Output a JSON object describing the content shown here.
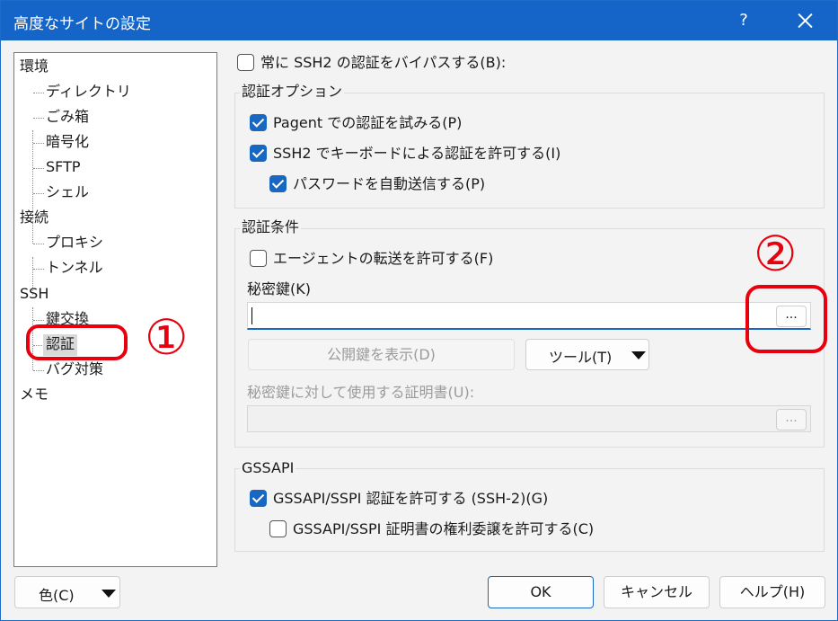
{
  "window": {
    "title": "高度なサイトの設定"
  },
  "titlebar": {
    "help_label": "?"
  },
  "tree": {
    "items": [
      {
        "label": "環境"
      },
      {
        "label": "ディレクトリ"
      },
      {
        "label": "ごみ箱"
      },
      {
        "label": "暗号化"
      },
      {
        "label": "SFTP"
      },
      {
        "label": "シェル"
      },
      {
        "label": "接続"
      },
      {
        "label": "プロキシ"
      },
      {
        "label": "トンネル"
      },
      {
        "label": "SSH"
      },
      {
        "label": "鍵交換"
      },
      {
        "label": "認証",
        "selected": true
      },
      {
        "label": "バグ対策"
      },
      {
        "label": "メモ"
      }
    ]
  },
  "annotations": {
    "mark1": "①",
    "mark2": "②",
    "color": "#e8000f"
  },
  "bypass": {
    "label": "常に SSH2 の認証をバイパスする(B):",
    "checked": false
  },
  "auth_options": {
    "title": "認証オプション",
    "pageant": {
      "label": "Pagent での認証を試みる(P)",
      "checked": true
    },
    "keyboard": {
      "label": "SSH2 でキーボードによる認証を許可する(I)",
      "checked": true
    },
    "password": {
      "label": "パスワードを自動送信する(P)",
      "checked": true
    }
  },
  "auth_conditions": {
    "title": "認証条件",
    "agent_forward": {
      "label": "エージェントの転送を許可する(F)",
      "checked": false
    },
    "private_key_label": "秘密鍵(K)",
    "private_key_value": "",
    "browse_label": "...",
    "show_public_key_label": "公開鍵を表示(D)",
    "tools_label": "ツール(T)",
    "certificate_label": "秘密鍵に対して使用する証明書(U):",
    "certificate_value": "",
    "cert_browse_label": "..."
  },
  "gssapi": {
    "title": "GSSAPI",
    "allow": {
      "label": "GSSAPI/SSPI 認証を許可する (SSH-2)(G)",
      "checked": true
    },
    "delegate": {
      "label": "GSSAPI/SSPI 証明書の権利委譲を許可する(C)",
      "checked": false
    }
  },
  "footer": {
    "color_label": "色(C)",
    "ok_label": "OK",
    "cancel_label": "キャンセル",
    "help_label": "ヘルプ(H)"
  },
  "colors": {
    "accent": "#1767c3",
    "titlebar": "#1565c8"
  }
}
